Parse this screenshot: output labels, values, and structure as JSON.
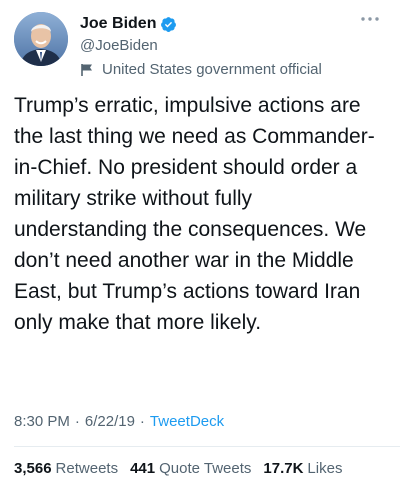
{
  "author": {
    "name": "Joe Biden",
    "handle": "@JoeBiden",
    "label": "United States government official",
    "verified": true,
    "avatar_icon": "avatar-photo"
  },
  "tweet": {
    "text": "Trump’s erratic, impulsive actions are the last thing we need as Commander-in-Chief. No president should order a military strike without fully understanding the consequences. We don’t need another war in the Middle East, but Trump’s actions toward Iran only make that more likely.",
    "time": "8:30 PM",
    "date": "6/22/19",
    "separator": "·",
    "source": "TweetDeck"
  },
  "stats": {
    "retweets_count": "3,566",
    "retweets_label": "Retweets",
    "quotes_count": "441",
    "quotes_label": "Quote Tweets",
    "likes_count": "17.7K",
    "likes_label": "Likes"
  },
  "icons": {
    "verified": "verified-badge-icon",
    "label": "flag-icon",
    "more": "more-options-icon"
  },
  "colors": {
    "accent": "#1d9bf0",
    "secondary_text": "#536471",
    "primary_text": "#0f1419",
    "divider": "#e6ecf0"
  }
}
